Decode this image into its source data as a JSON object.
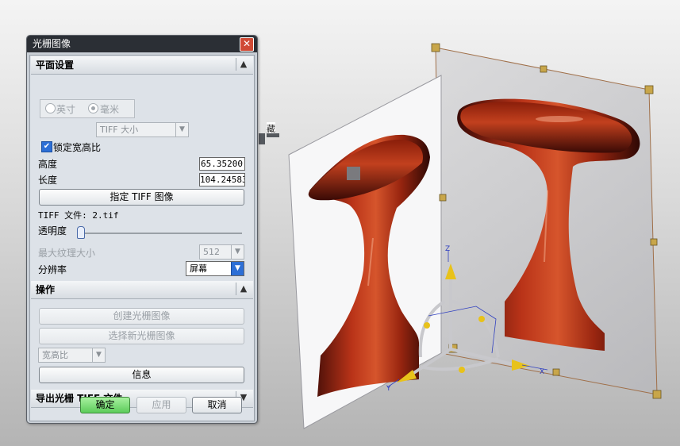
{
  "dialog": {
    "title": "光栅图像",
    "close_glyph": "✕",
    "plane_section": {
      "header": "平面设置",
      "unit_options": [
        "英寸",
        "毫米"
      ],
      "unit_selected": "毫米",
      "tiff_size_select": "TIFF 大小",
      "lock_aspect_label": "锁定宽高比",
      "lock_aspect_checked": true,
      "height_label": "高度",
      "height_value": "65.35200",
      "length_label": "长度",
      "length_value": "104.24583",
      "specify_tiff_button": "指定 TIFF 图像",
      "tiff_file_text": "TIFF 文件: 2.tif",
      "transparency_label": "透明度",
      "transparency_value": 0,
      "max_texture_label": "最大纹理大小",
      "max_texture_value": "512",
      "resolution_label": "分辨率",
      "resolution_value": "屏幕"
    },
    "operations_section": {
      "header": "操作",
      "create_button": "创建光栅图像",
      "select_new_button": "选择新光栅图像",
      "aspect_select": "宽高比",
      "info_button": "信息"
    },
    "export_section": {
      "header": "导出光栅 TIFF 文件"
    },
    "footer": {
      "ok": "确定",
      "apply": "应用",
      "cancel": "取消"
    }
  },
  "viewport": {
    "partial_label": "藏",
    "axes": {
      "x": "X",
      "y": "Y",
      "z": "Z"
    },
    "colors": {
      "handle": "#c8a64a",
      "object_red": "#a82a12",
      "axis_arrow": "#e8c21a",
      "frame_line": "#a0704a"
    }
  }
}
